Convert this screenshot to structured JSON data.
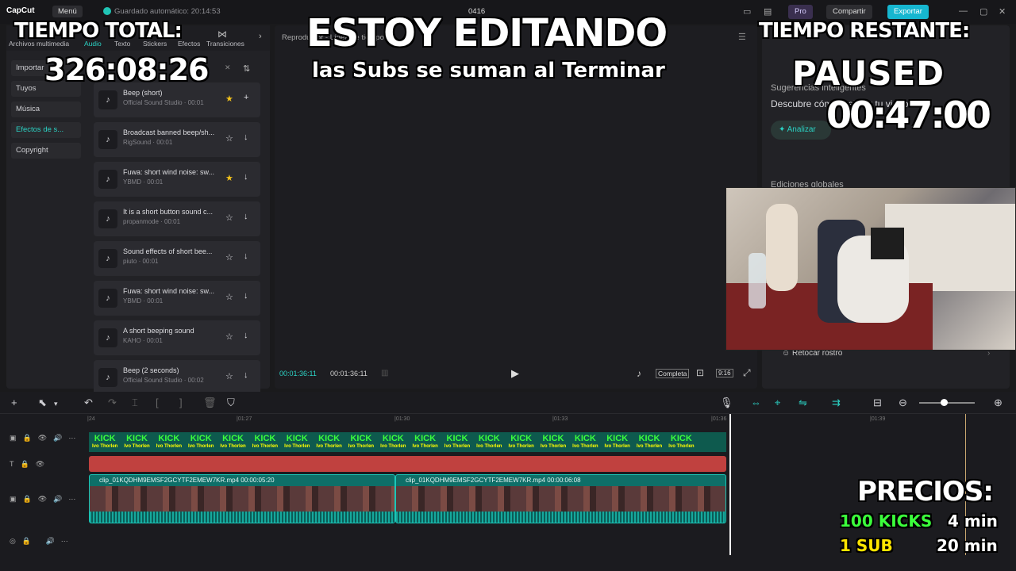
{
  "app": {
    "logo": "CapCut",
    "menu": "Menú",
    "autosave": "Guardado automático: 20:14:53",
    "project": "0416",
    "pro": "Pro",
    "share": "Compartir",
    "export": "Exportar"
  },
  "media_tabs": [
    "Archivos multimedia",
    "Audio",
    "Texto",
    "Stickers",
    "Efectos",
    "Transiciones"
  ],
  "side_nav": [
    {
      "label": "Importar",
      "active": false
    },
    {
      "label": "Tuyos",
      "active": false
    },
    {
      "label": "Música",
      "active": false
    },
    {
      "label": "Efectos de s...",
      "active": true
    },
    {
      "label": "Copyright",
      "active": false
    }
  ],
  "sounds": [
    {
      "name": "Beep (short)",
      "source": "Official Sound Studio · 00:01",
      "fav": true,
      "action": "+"
    },
    {
      "name": "Broadcast banned beep/sh...",
      "source": "RigSound · 00:01",
      "fav": false,
      "action": "↓"
    },
    {
      "name": "Fuwa: short wind noise: sw...",
      "source": "YBMD · 00:01",
      "fav": true,
      "action": "↓"
    },
    {
      "name": "It is a short button sound c...",
      "source": "propanmode · 00:01",
      "fav": false,
      "action": "↓"
    },
    {
      "name": "Sound effects of short bee...",
      "source": "piuto · 00:01",
      "fav": false,
      "action": "↓"
    },
    {
      "name": "Fuwa: short wind noise: sw...",
      "source": "YBMD · 00:01",
      "fav": false,
      "action": "↓"
    },
    {
      "name": "A short beeping sound",
      "source": "KAHO · 00:01",
      "fav": false,
      "action": "↓"
    },
    {
      "name": "Beep (2 seconds)",
      "source": "Official Sound Studio · 00:02",
      "fav": false,
      "action": "↓"
    }
  ],
  "player": {
    "header": "Reproductor - Línea de tiempo",
    "current": "00:01:36:11",
    "duration": "00:01:36:11",
    "completa": "Completa",
    "ratio": "9:16"
  },
  "right": {
    "suggestions": "Sugerencias inteligentes",
    "discover": "Descubre cómo mejorar tu video",
    "analyze": "Analizar",
    "global_edits": "Ediciones globales",
    "retouch": "Retocar rostro"
  },
  "ruler": [
    "|24",
    "|01:27",
    "|01:30",
    "|01:33",
    "|01:36",
    "|01:39"
  ],
  "kick_banner": {
    "text": "KICK",
    "sub": "Ivo Thorlen"
  },
  "clips": [
    {
      "label": "clip_01KQDHM9EMSF2GCYTF2EMEW7KR.mp4   00:00:05:20"
    },
    {
      "label": "clip_01KQDHM9EMSF2GCYTF2EMEW7KR.mp4   00:00:06:08"
    }
  ],
  "overlay": {
    "total_label": "TIEMPO TOTAL:",
    "total_value": "326:08:26",
    "heading": "ESTOY EDITANDO",
    "subheading": "las Subs se suman al Terminar",
    "remaining_label": "TIEMPO RESTANTE:",
    "status": "PAUSED",
    "remaining_value": "00:47:00",
    "prices_label": "PRECIOS:",
    "prices": [
      {
        "item": "100 KICKS",
        "value": "4 min",
        "color": "#3bff3b"
      },
      {
        "item": "1 SUB",
        "value": "20 min",
        "color": "#ffe600"
      }
    ]
  }
}
